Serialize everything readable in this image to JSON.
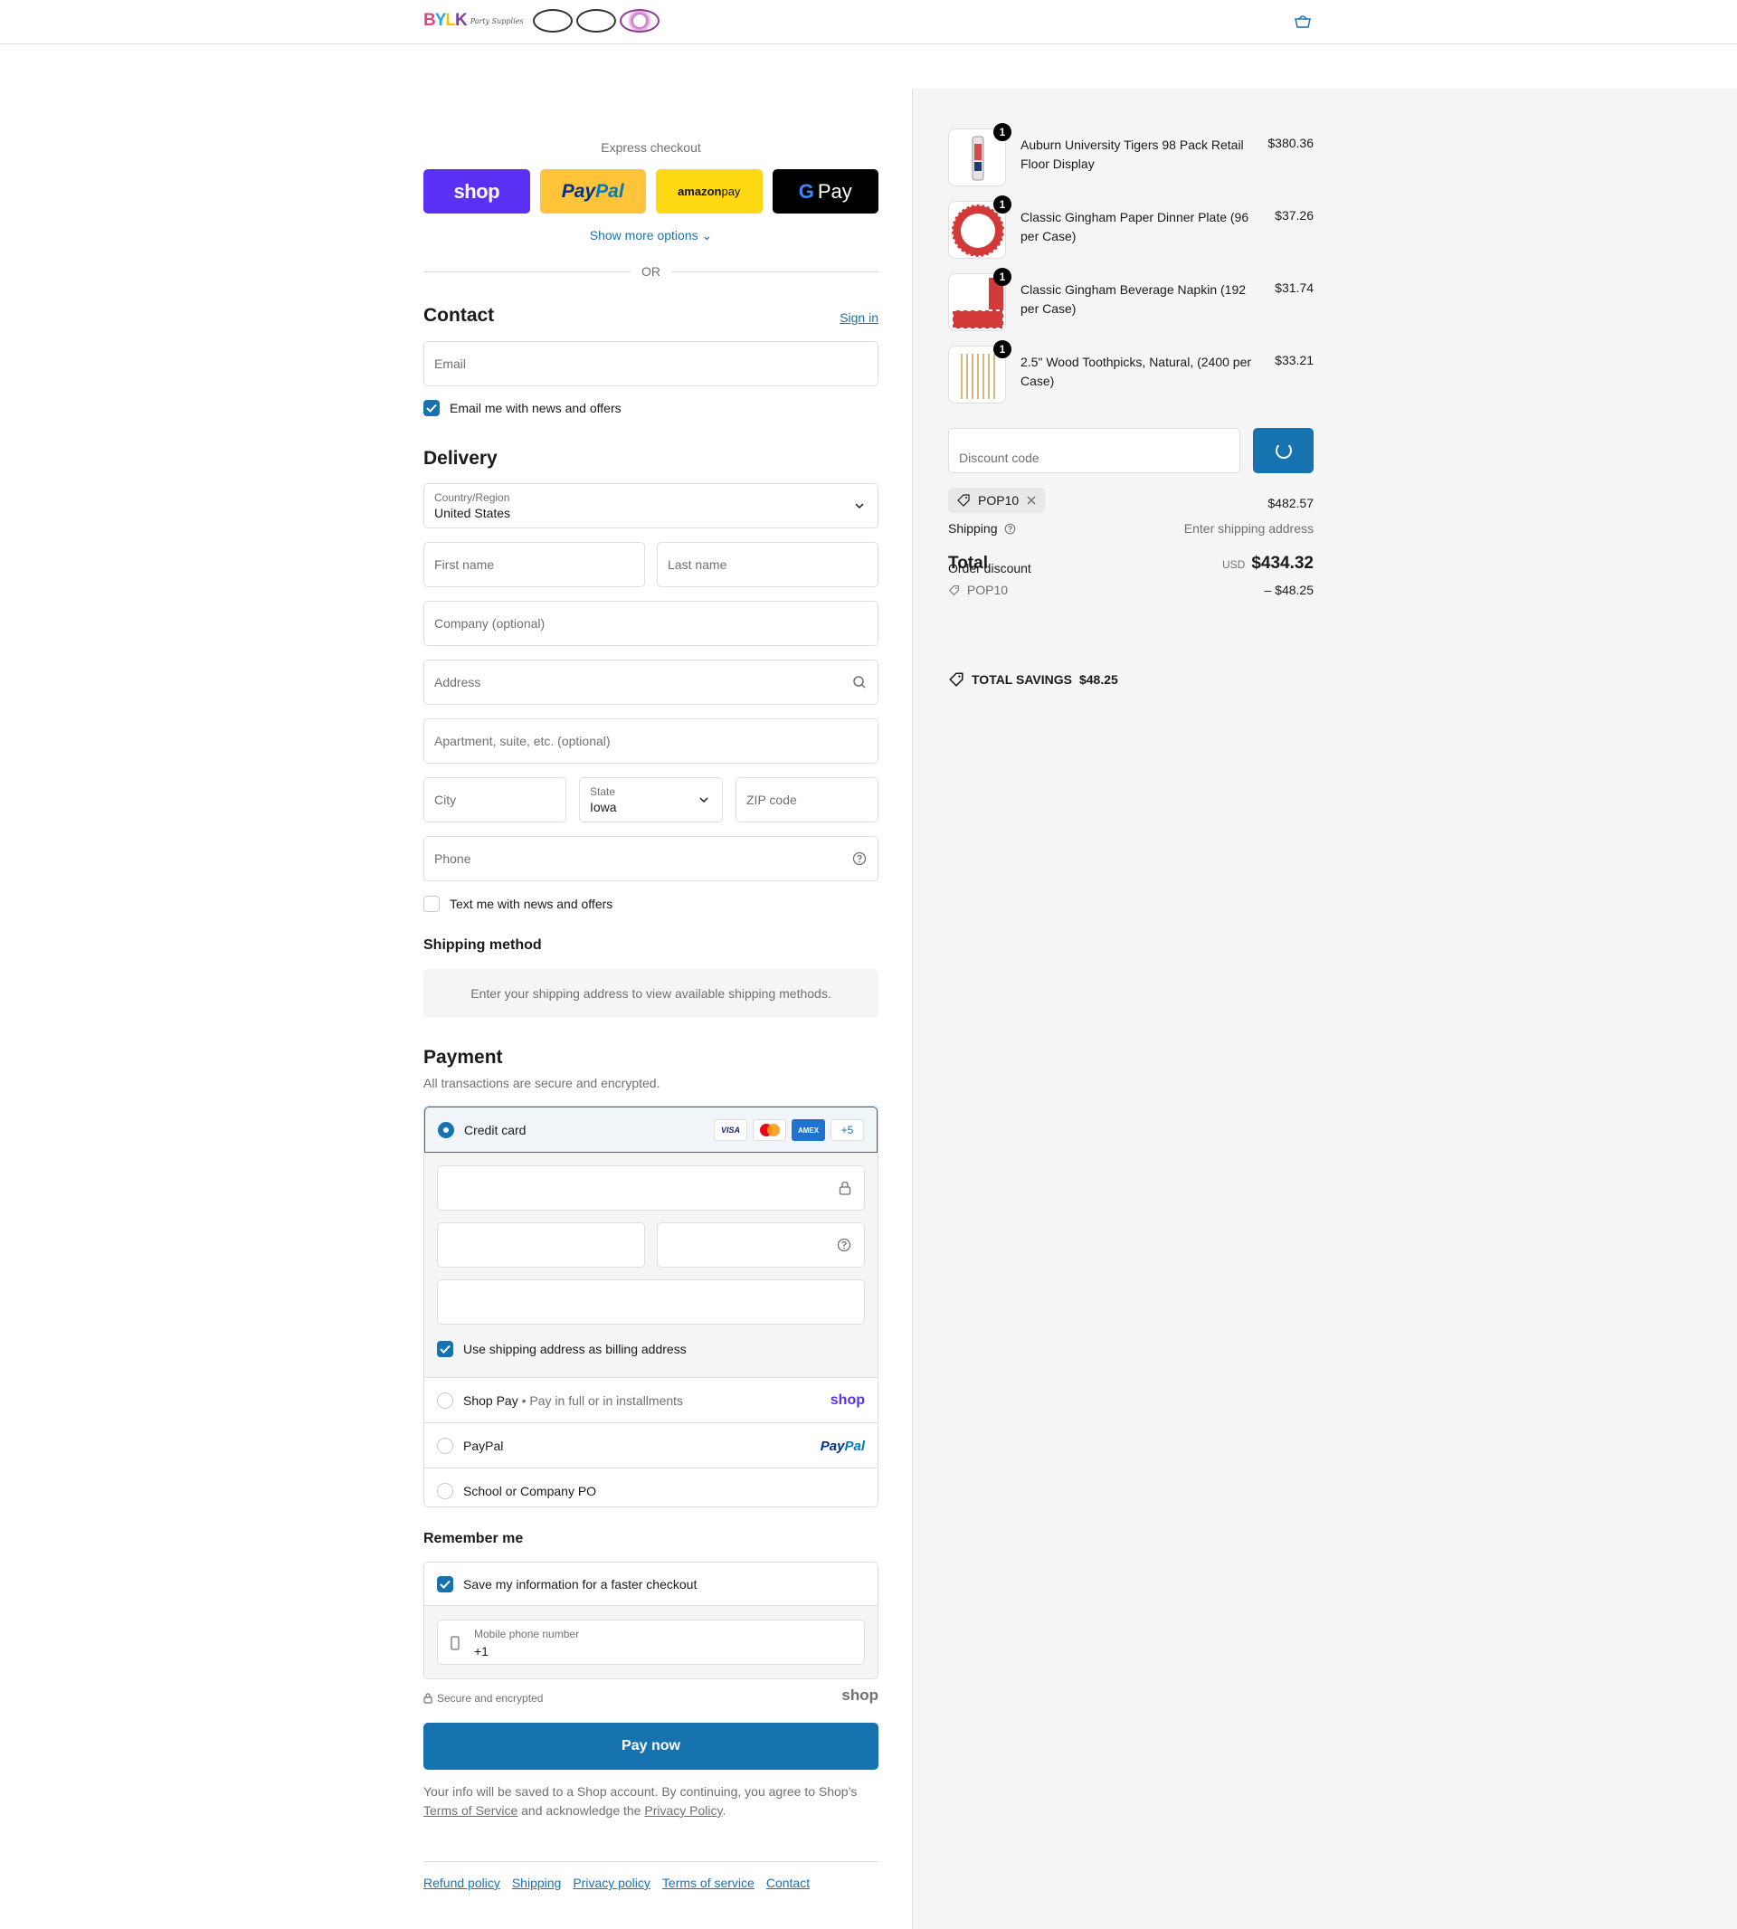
{
  "header": {
    "logo_script": "Party Supplies",
    "logo_letters": [
      "B",
      "Y",
      "L",
      "K"
    ]
  },
  "express": {
    "title": "Express checkout",
    "shop_label": "shop",
    "paypal_label_a": "Pay",
    "paypal_label_b": "Pal",
    "amazon_label_a": "amazon",
    "amazon_label_b": " pay",
    "gpay_g": "G",
    "gpay_label": "Pay",
    "more_options": "Show more options",
    "or": "OR"
  },
  "contact": {
    "title": "Contact",
    "sign_in": "Sign in",
    "email_placeholder": "Email",
    "news_label": "Email me with news and offers"
  },
  "delivery": {
    "title": "Delivery",
    "country_label": "Country/Region",
    "country_value": "United States",
    "first_name": "First name",
    "last_name": "Last name",
    "company": "Company (optional)",
    "address": "Address",
    "apartment": "Apartment, suite, etc. (optional)",
    "city": "City",
    "state_label": "State",
    "state_value": "Iowa",
    "zip": "ZIP code",
    "phone": "Phone",
    "text_label": "Text me with news and offers"
  },
  "shipping_method": {
    "title": "Shipping method",
    "note": "Enter your shipping address to view available shipping methods."
  },
  "payment": {
    "title": "Payment",
    "subtitle": "All transactions are secure and encrypted.",
    "credit_card": "Credit card",
    "brands": {
      "visa": "VISA",
      "amex": "AMEX",
      "more": "+5"
    },
    "billing_label": "Use shipping address as billing address",
    "shop_pay": "Shop Pay",
    "shop_pay_sub": "Pay in full or in installments",
    "shop_mark": "shop",
    "paypal": "PayPal",
    "paypal_mark_a": "Pay",
    "paypal_mark_b": "Pal",
    "po": "School or Company PO"
  },
  "remember": {
    "title": "Remember me",
    "save_label": "Save my information for a faster checkout",
    "mobile_label": "Mobile phone number",
    "mobile_value": "+1"
  },
  "secure": {
    "label": "Secure and encrypted",
    "shop": "shop"
  },
  "pay_now": "Pay now",
  "legal": {
    "text_a": "Your info will be saved to a Shop account. By continuing, you agree to Shop’s",
    "terms": "Terms of Service",
    "text_b": " and acknowledge the ",
    "privacy": "Privacy Policy",
    "text_c": "."
  },
  "footer": [
    "Refund policy",
    "Shipping",
    "Privacy policy",
    "Terms of service",
    "Contact"
  ],
  "cart": {
    "items": [
      {
        "qty": "1",
        "name": "Auburn University Tigers 98 Pack Retail Floor Display",
        "price": "$380.36"
      },
      {
        "qty": "1",
        "name": "Classic Gingham Paper Dinner Plate (96 per Case)",
        "price": "$37.26"
      },
      {
        "qty": "1",
        "name": "Classic Gingham Beverage Napkin (192 per Case)",
        "price": "$31.74"
      },
      {
        "qty": "1",
        "name": "2.5\" Wood Toothpicks, Natural, (2400 per Case)",
        "price": "$33.21"
      }
    ],
    "discount_placeholder": "Discount code",
    "applied_code": "POP10",
    "subtotal": "$482.57",
    "shipping_label": "Shipping",
    "shipping_value": "Enter shipping address",
    "order_discount_label": "Order discount",
    "order_discount_code": "POP10",
    "order_discount_value": "– $48.25",
    "total_label": "Total",
    "currency": "USD",
    "total_value": "$434.32",
    "savings_label": "TOTAL SAVINGS",
    "savings_value": "$48.25"
  },
  "colors": {
    "accent": "#1773b0",
    "shop_purple": "#5a31f4",
    "paypal_yellow": "#ffc439",
    "amazon_yellow": "#ffd814"
  }
}
